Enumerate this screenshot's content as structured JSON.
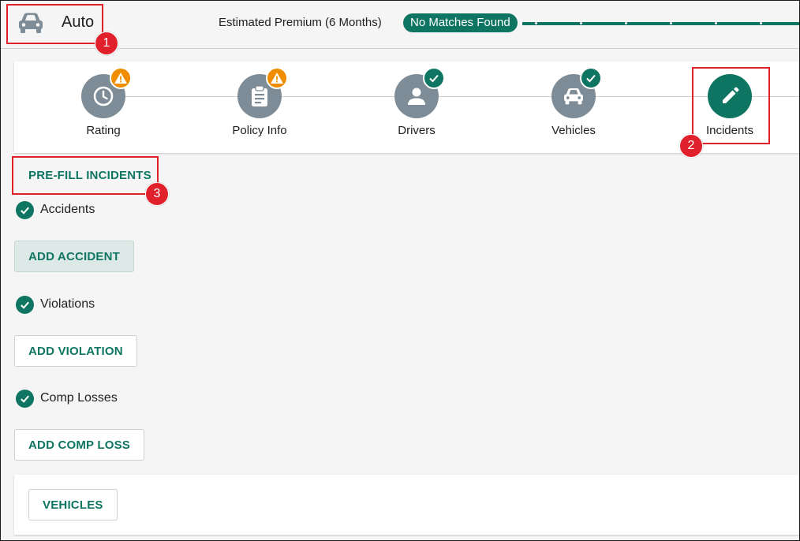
{
  "header": {
    "title": "Auto",
    "car_icon": "car-icon",
    "premium_label": "Estimated Premium (6 Months)",
    "premium_status": "No Matches Found"
  },
  "stepper": {
    "steps": [
      {
        "label": "Rating",
        "icon": "clock-icon",
        "status": "warning"
      },
      {
        "label": "Policy Info",
        "icon": "clipboard-icon",
        "status": "warning"
      },
      {
        "label": "Drivers",
        "icon": "person-icon",
        "status": "done"
      },
      {
        "label": "Vehicles",
        "icon": "car-icon",
        "status": "done"
      },
      {
        "label": "Incidents",
        "icon": "pencil-icon",
        "status": "active"
      }
    ]
  },
  "incidents": {
    "prefill_label": "PRE-FILL INCIDENTS",
    "accidents_label": "Accidents",
    "add_accident_label": "ADD ACCIDENT",
    "violations_label": "Violations",
    "add_violation_label": "ADD VIOLATION",
    "comp_losses_label": "Comp Losses",
    "add_comp_loss_label": "ADD COMP LOSS"
  },
  "footer": {
    "vehicles_button_label": "VEHICLES"
  },
  "annotations": [
    "1",
    "2",
    "3"
  ],
  "colors": {
    "primary": "#0f7563",
    "step_inactive": "#7d8c96",
    "warning": "#f08c00",
    "annotation": "#e0202a"
  }
}
